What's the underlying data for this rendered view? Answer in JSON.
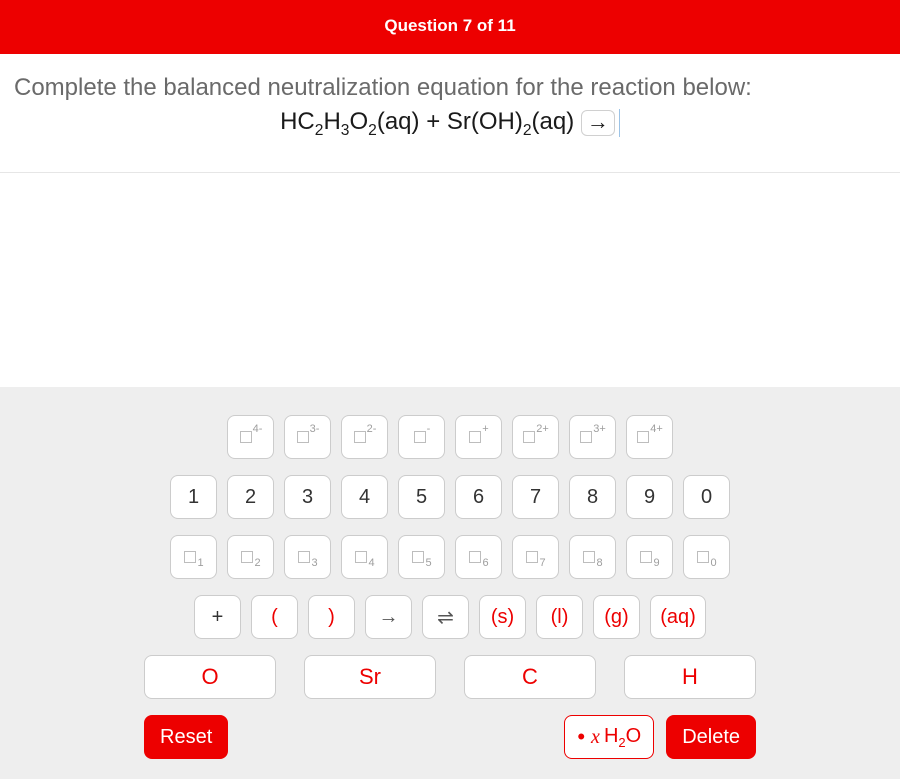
{
  "header": {
    "title": "Question 7 of 11"
  },
  "question": {
    "prompt": "Complete the balanced neutralization equation for the reaction below:",
    "equation_html": "HC<sub>2</sub>H<sub>3</sub>O<sub>2</sub>(aq) + Sr(OH)<sub>2</sub>(aq)"
  },
  "keyboard": {
    "charges": [
      "4-",
      "3-",
      "2-",
      "-",
      "+",
      "2+",
      "3+",
      "4+"
    ],
    "digits": [
      "1",
      "2",
      "3",
      "4",
      "5",
      "6",
      "7",
      "8",
      "9",
      "0"
    ],
    "subscripts": [
      "1",
      "2",
      "3",
      "4",
      "5",
      "6",
      "7",
      "8",
      "9",
      "0"
    ],
    "symbols": {
      "plus": "+",
      "lparen": "(",
      "rparen": ")",
      "fwd_arrow": "→",
      "equilibrium": "⇌",
      "state_s": "(s)",
      "state_l": "(l)",
      "state_g": "(g)",
      "state_aq": "(aq)"
    },
    "elements": [
      "O",
      "Sr",
      "C",
      "H"
    ],
    "reset": "Reset",
    "water": "H₂O",
    "delete": "Delete"
  }
}
